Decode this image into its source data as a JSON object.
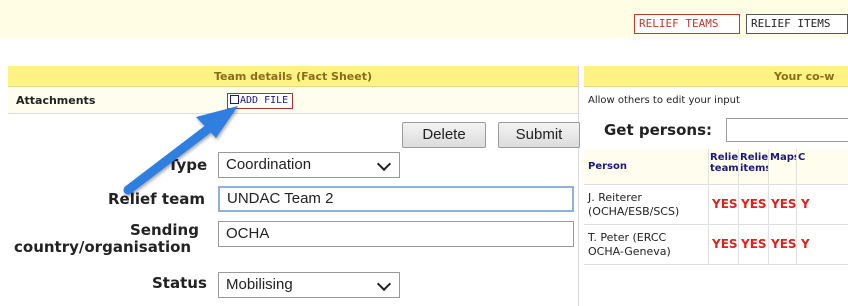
{
  "top_buttons": {
    "relief_teams": "RELIEF TEAMS",
    "relief_items": "RELIEF ITEMS"
  },
  "team_details": {
    "header": "Team details (Fact Sheet)",
    "attachments_label": "Attachments",
    "add_file_label": "ADD FILE",
    "delete_label": "Delete",
    "submit_label": "Submit",
    "fields": {
      "type_label": "Type",
      "type_value": "Coordination",
      "relief_team_label": "Relief team",
      "relief_team_value": "UNDAC Team 2",
      "sending_label_1": "Sending",
      "sending_label_2": "country/organisation",
      "sending_value": "OCHA",
      "status_label": "Status",
      "status_value": "Mobilising"
    }
  },
  "coworkers": {
    "header": "Your co-w",
    "allow_text": "Allow others to edit your input",
    "get_persons_label": "Get persons:",
    "get_persons_value": "",
    "columns": {
      "person": "Person",
      "relief_teams": "Relief teams",
      "relief_items": "Relief items",
      "maps": "Maps",
      "cut": "C"
    },
    "rows": [
      {
        "name_line1": "J. Reiterer",
        "name_line2": "(OCHA/ESB/SCS)",
        "relief_teams": "YES",
        "relief_items": "YES",
        "maps": "YES",
        "cut": "Y"
      },
      {
        "name_line1": "T. Peter (ERCC",
        "name_line2": "OCHA-Geneva)",
        "relief_teams": "YES",
        "relief_items": "YES",
        "maps": "YES",
        "cut": "Y"
      }
    ]
  },
  "colors": {
    "header_yellow": "#fff284",
    "top_band": "#fffde4",
    "yes_red": "#e02020",
    "arrow_blue": "#2f7fe0"
  },
  "icons": [
    "checkbox-icon",
    "chevron-down-icon",
    "pointer-arrow-icon"
  ]
}
